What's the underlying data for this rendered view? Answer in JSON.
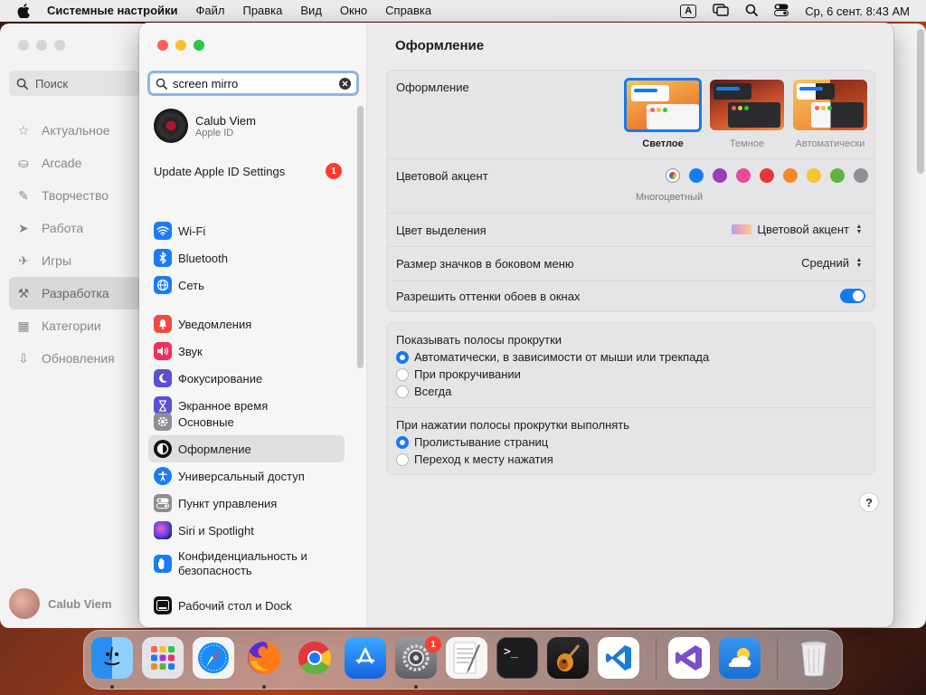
{
  "menubar": {
    "app_name": "Системные настройки",
    "menus": [
      "Файл",
      "Правка",
      "Вид",
      "Окно",
      "Справка"
    ],
    "input_source": "A",
    "datetime": "Ср, 6 сент.  8:43 AM"
  },
  "back_window": {
    "search_placeholder": "Поиск",
    "nav": [
      {
        "label": "Актуальное",
        "icon": "star-icon"
      },
      {
        "label": "Arcade",
        "icon": "joystick-icon"
      },
      {
        "label": "Творчество",
        "icon": "brush-icon"
      },
      {
        "label": "Работа",
        "icon": "paper-plane-icon"
      },
      {
        "label": "Игры",
        "icon": "rocket-icon"
      },
      {
        "label": "Разработка",
        "icon": "hammer-icon",
        "active": true
      },
      {
        "label": "Категории",
        "icon": "grid-icon"
      },
      {
        "label": "Обновления",
        "icon": "download-icon"
      }
    ],
    "user_name": "Calub Viem"
  },
  "sidebar": {
    "search_value": "screen mirro",
    "apple_id": {
      "name": "Calub Viem",
      "sub": "Apple ID"
    },
    "update": {
      "label": "Update Apple ID Settings",
      "badge": "1"
    },
    "groups": [
      [
        {
          "label": "Wi-Fi",
          "icon": "wifi-icon",
          "color": "#1a7cf5"
        },
        {
          "label": "Bluetooth",
          "icon": "bluetooth-icon",
          "color": "#1a7cf5"
        },
        {
          "label": "Сеть",
          "icon": "globe-icon",
          "color": "#1a7cf5"
        }
      ],
      [
        {
          "label": "Уведомления",
          "icon": "bell-icon",
          "color": "#f24b3f"
        },
        {
          "label": "Звук",
          "icon": "speaker-icon",
          "color": "#f0305c"
        },
        {
          "label": "Фокусирование",
          "icon": "moon-icon",
          "color": "#5b4fd6"
        },
        {
          "label": "Экранное время",
          "icon": "hourglass-icon",
          "color": "#5b4fd6"
        }
      ],
      [
        {
          "label": "Основные",
          "icon": "gear-icon",
          "color": "#8e8e93"
        },
        {
          "label": "Оформление",
          "icon": "appearance-icon",
          "color": "#111111",
          "active": true
        },
        {
          "label": "Универсальный доступ",
          "icon": "accessibility-icon",
          "color": "#1a7cf5"
        },
        {
          "label": "Пункт управления",
          "icon": "control-center-icon",
          "color": "#8e8e93"
        },
        {
          "label": "Siri и Spotlight",
          "icon": "siri-icon",
          "color": "#a03cd6"
        },
        {
          "label": "Конфиденциальность и безопасность",
          "icon": "hand-icon",
          "color": "#1a7cf5",
          "two_line": true
        }
      ],
      [
        {
          "label": "Рабочий стол и Dock",
          "icon": "dock-icon",
          "color": "#111111"
        }
      ]
    ]
  },
  "content": {
    "title": "Оформление",
    "appearance": {
      "label": "Оформление",
      "options": [
        {
          "label": "Светлое",
          "selected": true
        },
        {
          "label": "Темное",
          "selected": false
        },
        {
          "label": "Автоматически",
          "selected": false
        }
      ]
    },
    "accent": {
      "label": "Цветовой акцент",
      "selected_caption": "Многоцветный",
      "colors": [
        "multicolor",
        "#1a7cf5",
        "#9b3fb5",
        "#e94b9c",
        "#e0383e",
        "#f5892b",
        "#f6c431",
        "#5fb43f",
        "#8e8e93"
      ]
    },
    "highlight": {
      "label": "Цвет выделения",
      "value": "Цветовой акцент"
    },
    "icon_size": {
      "label": "Размер значков в боковом меню",
      "value": "Средний"
    },
    "wallpaper_tint": {
      "label": "Разрешить оттенки обоев в окнах",
      "on": true
    },
    "scrollbars": {
      "label": "Показывать полосы прокрутки",
      "options": [
        {
          "label": "Автоматически, в зависимости от мыши или трекпада",
          "selected": true
        },
        {
          "label": "При прокручивании",
          "selected": false
        },
        {
          "label": "Всегда",
          "selected": false
        }
      ]
    },
    "click_scroll": {
      "label": "При нажатии полосы прокрутки выполнять",
      "options": [
        {
          "label": "Пролистывание страниц",
          "selected": true
        },
        {
          "label": "Переход к месту нажатия",
          "selected": false
        }
      ]
    },
    "help": "?"
  },
  "dock": {
    "apps": [
      "Finder",
      "Launchpad",
      "Safari",
      "Firefox",
      "Chrome",
      "App Store",
      "Системные настройки",
      "TextEdit",
      "Terminal",
      "GarageBand",
      "Visual Studio Code",
      "Visual Studio",
      "Weather",
      "Корзина"
    ],
    "settings_badge": "1"
  }
}
